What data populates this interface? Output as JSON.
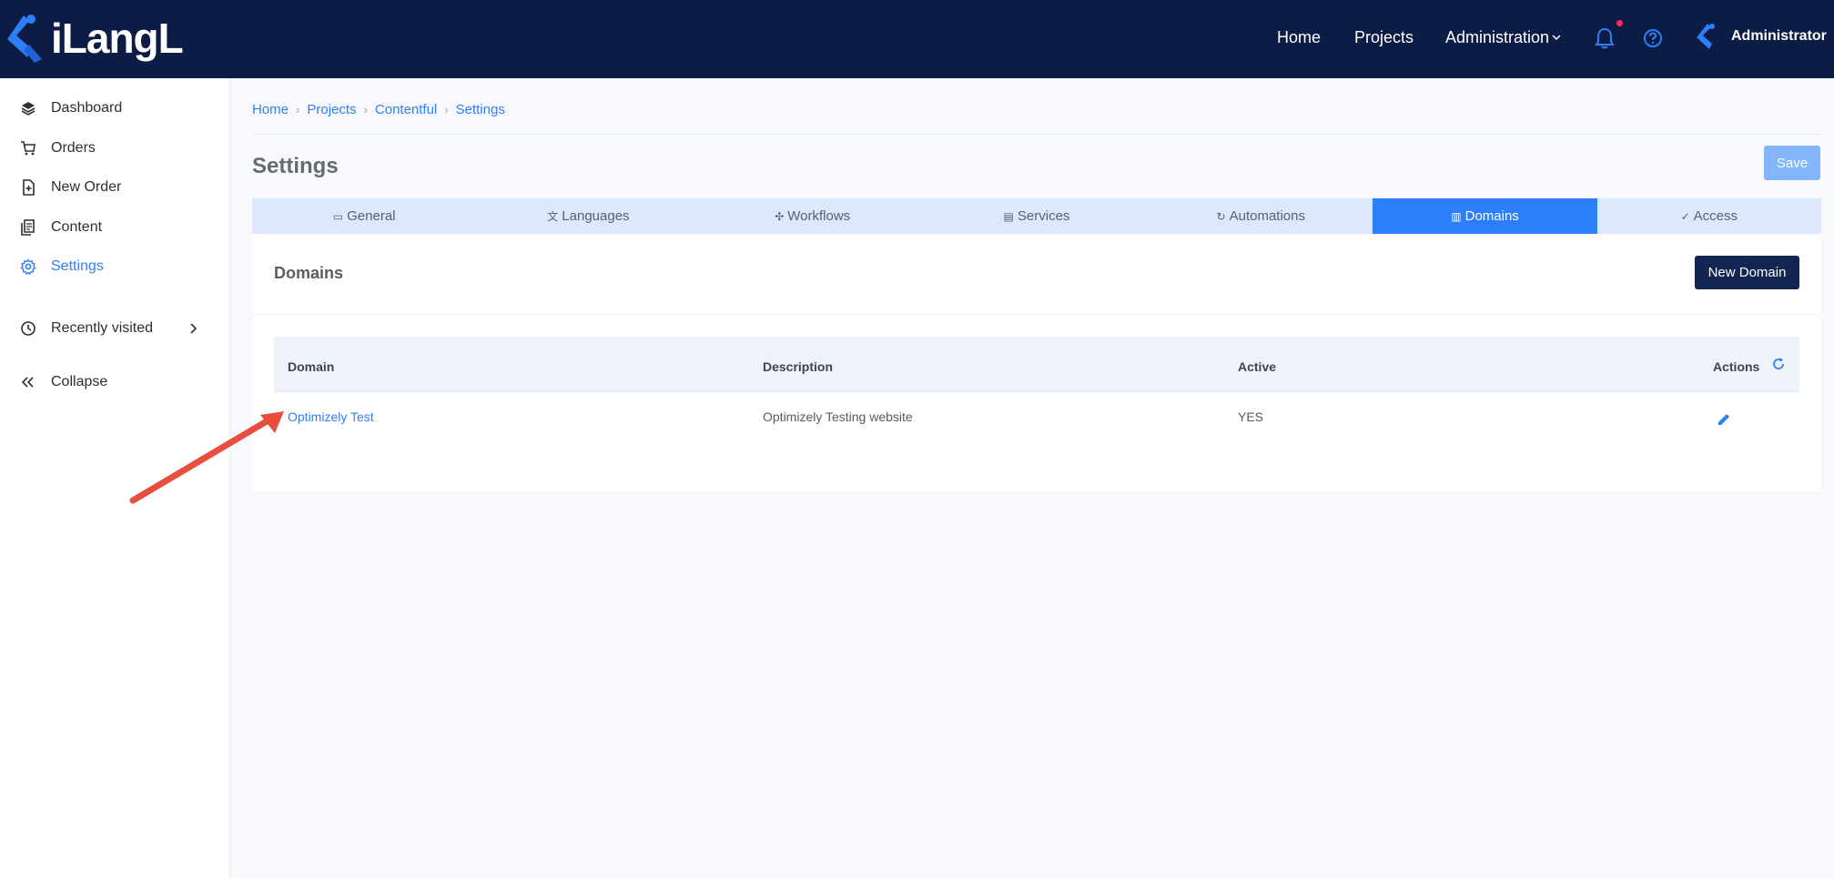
{
  "app": {
    "logo_text": "iLangL",
    "brand_color": "#2d7ff9",
    "topbar_color": "#0c1c45"
  },
  "topnav": {
    "home": "Home",
    "projects": "Projects",
    "administration": "Administration",
    "user": "Administrator",
    "icons": [
      "bell-icon",
      "help-icon",
      "chevron-down-icon"
    ]
  },
  "sidebar": {
    "items": [
      {
        "label": "Dashboard",
        "icon": "layers-icon"
      },
      {
        "label": "Orders",
        "icon": "cart-icon"
      },
      {
        "label": "New Order",
        "icon": "file-plus-icon"
      },
      {
        "label": "Content",
        "icon": "documents-icon"
      },
      {
        "label": "Settings",
        "icon": "gear-icon",
        "active": true
      },
      {
        "label": "Recently visited",
        "icon": "history-icon"
      },
      {
        "label": "Collapse",
        "icon": "double-chevron-left-icon"
      }
    ]
  },
  "breadcrumb": [
    "Home",
    "Projects",
    "Contentful",
    "Settings"
  ],
  "page": {
    "title": "Settings",
    "save_label": "Save"
  },
  "tabs": [
    {
      "label": "General",
      "icon": "tablet-icon"
    },
    {
      "label": "Languages",
      "icon": "translate-icon"
    },
    {
      "label": "Workflows",
      "icon": "workflow-icon"
    },
    {
      "label": "Services",
      "icon": "server-icon"
    },
    {
      "label": "Automations",
      "icon": "sync-icon"
    },
    {
      "label": "Domains",
      "icon": "building-icon",
      "active": true
    },
    {
      "label": "Access",
      "icon": "shield-check-icon"
    }
  ],
  "domains": {
    "title": "Domains",
    "new_button": "New Domain",
    "columns": [
      "Domain",
      "Description",
      "Active",
      "Actions"
    ],
    "rows": [
      {
        "domain": "Optimizely Test",
        "description": "Optimizely Testing website",
        "active": "YES"
      }
    ]
  }
}
